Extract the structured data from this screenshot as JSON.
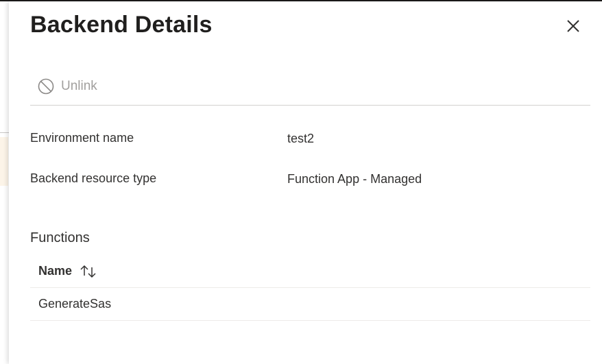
{
  "panel": {
    "title": "Backend Details",
    "close_icon": "close-icon"
  },
  "toolbar": {
    "unlink_label": "Unlink",
    "unlink_icon": "blocked-icon",
    "unlink_disabled": true
  },
  "details": {
    "environment_name_label": "Environment name",
    "environment_name_value": "test2",
    "backend_type_label": "Backend resource type",
    "backend_type_value": "Function App - Managed"
  },
  "functions": {
    "section_label": "Functions",
    "columns": [
      {
        "label": "Name",
        "sort_icon": "sort-icon"
      }
    ],
    "rows": [
      {
        "name": "GenerateSas"
      }
    ]
  }
}
